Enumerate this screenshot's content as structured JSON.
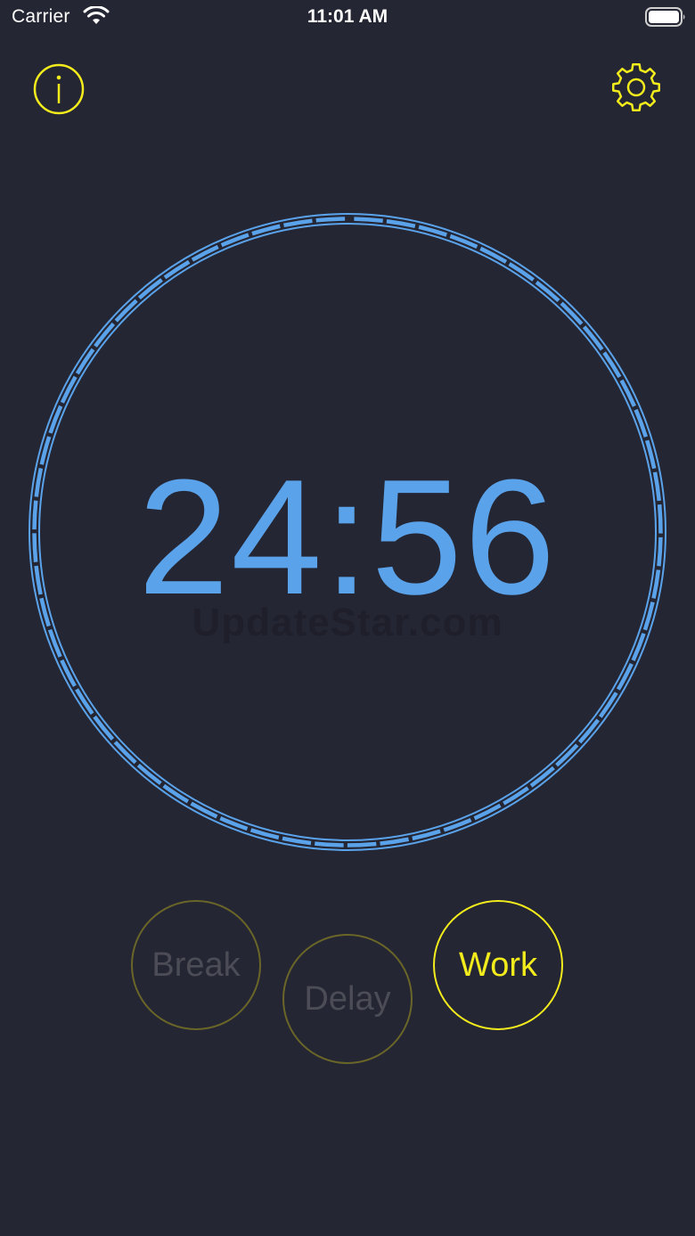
{
  "status_bar": {
    "carrier": "Carrier",
    "time": "11:01 AM"
  },
  "header": {
    "info_icon": "info-icon",
    "settings_icon": "gear-icon"
  },
  "timer": {
    "display": "24:56",
    "watermark": "UpdateStar.com",
    "progress_fraction": 0.9973
  },
  "modes": {
    "break_label": "Break",
    "delay_label": "Delay",
    "work_label": "Work",
    "selected": "Work"
  },
  "colors": {
    "background": "#252634",
    "accent_yellow": "#f2ec1c",
    "timer_blue": "#5aa3ea"
  }
}
